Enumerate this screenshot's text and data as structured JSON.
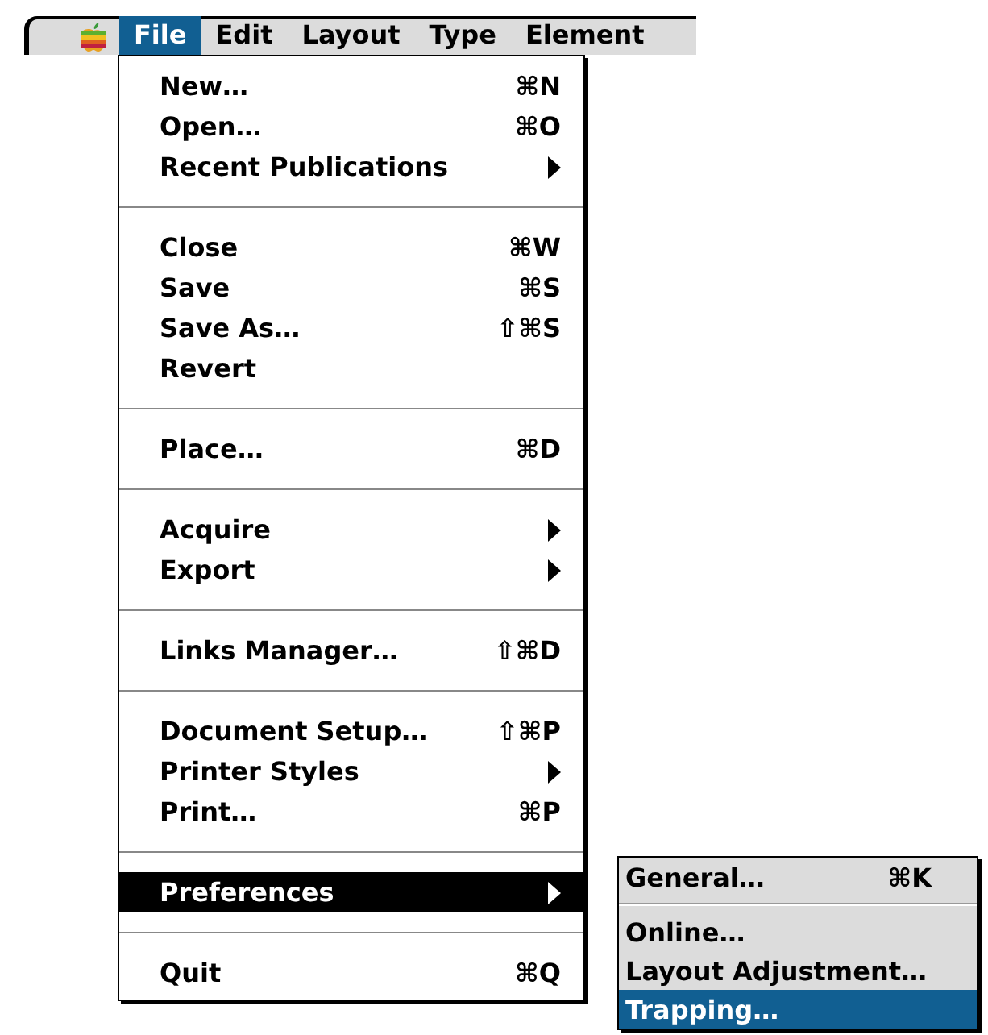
{
  "menubar": [
    {
      "label": "File",
      "selected": true
    },
    {
      "label": "Edit",
      "selected": false
    },
    {
      "label": "Layout",
      "selected": false
    },
    {
      "label": "Type",
      "selected": false
    },
    {
      "label": "Element",
      "selected": false
    }
  ],
  "file_menu": [
    {
      "kind": "item",
      "label": "New…",
      "shortcut": "⌘N",
      "submenu": false,
      "selected": false
    },
    {
      "kind": "item",
      "label": "Open…",
      "shortcut": "⌘O",
      "submenu": false,
      "selected": false
    },
    {
      "kind": "item",
      "label": "Recent Publications",
      "submenu": true,
      "selected": false
    },
    {
      "kind": "separator"
    },
    {
      "kind": "item",
      "label": "Close",
      "shortcut": "⌘W",
      "submenu": false,
      "selected": false
    },
    {
      "kind": "item",
      "label": "Save",
      "shortcut": "⌘S",
      "submenu": false,
      "selected": false
    },
    {
      "kind": "item",
      "label": "Save As…",
      "shortcut": "⇧⌘S",
      "submenu": false,
      "selected": false
    },
    {
      "kind": "item",
      "label": "Revert",
      "submenu": false,
      "selected": false
    },
    {
      "kind": "separator"
    },
    {
      "kind": "item",
      "label": "Place…",
      "shortcut": "⌘D",
      "submenu": false,
      "selected": false
    },
    {
      "kind": "separator"
    },
    {
      "kind": "item",
      "label": "Acquire",
      "submenu": true,
      "selected": false
    },
    {
      "kind": "item",
      "label": "Export",
      "submenu": true,
      "selected": false
    },
    {
      "kind": "separator"
    },
    {
      "kind": "item",
      "label": "Links Manager…",
      "shortcut": "⇧⌘D",
      "submenu": false,
      "selected": false
    },
    {
      "kind": "separator"
    },
    {
      "kind": "item",
      "label": "Document Setup…",
      "shortcut": "⇧⌘P",
      "submenu": false,
      "selected": false
    },
    {
      "kind": "item",
      "label": "Printer Styles",
      "submenu": true,
      "selected": false
    },
    {
      "kind": "item",
      "label": "Print…",
      "shortcut": "⌘P",
      "submenu": false,
      "selected": false
    },
    {
      "kind": "separator"
    },
    {
      "kind": "item",
      "label": "Preferences",
      "submenu": true,
      "selected": true
    },
    {
      "kind": "separator"
    },
    {
      "kind": "item",
      "label": "Quit",
      "shortcut": "⌘Q",
      "submenu": false,
      "selected": false
    }
  ],
  "preferences_submenu": [
    {
      "kind": "item",
      "label": "General…",
      "shortcut": "⌘K",
      "selected": false
    },
    {
      "kind": "separator"
    },
    {
      "kind": "item",
      "label": "Online…",
      "selected": false
    },
    {
      "kind": "item",
      "label": "Layout Adjustment…",
      "selected": false
    },
    {
      "kind": "item",
      "label": "Trapping…",
      "selected": true
    }
  ]
}
